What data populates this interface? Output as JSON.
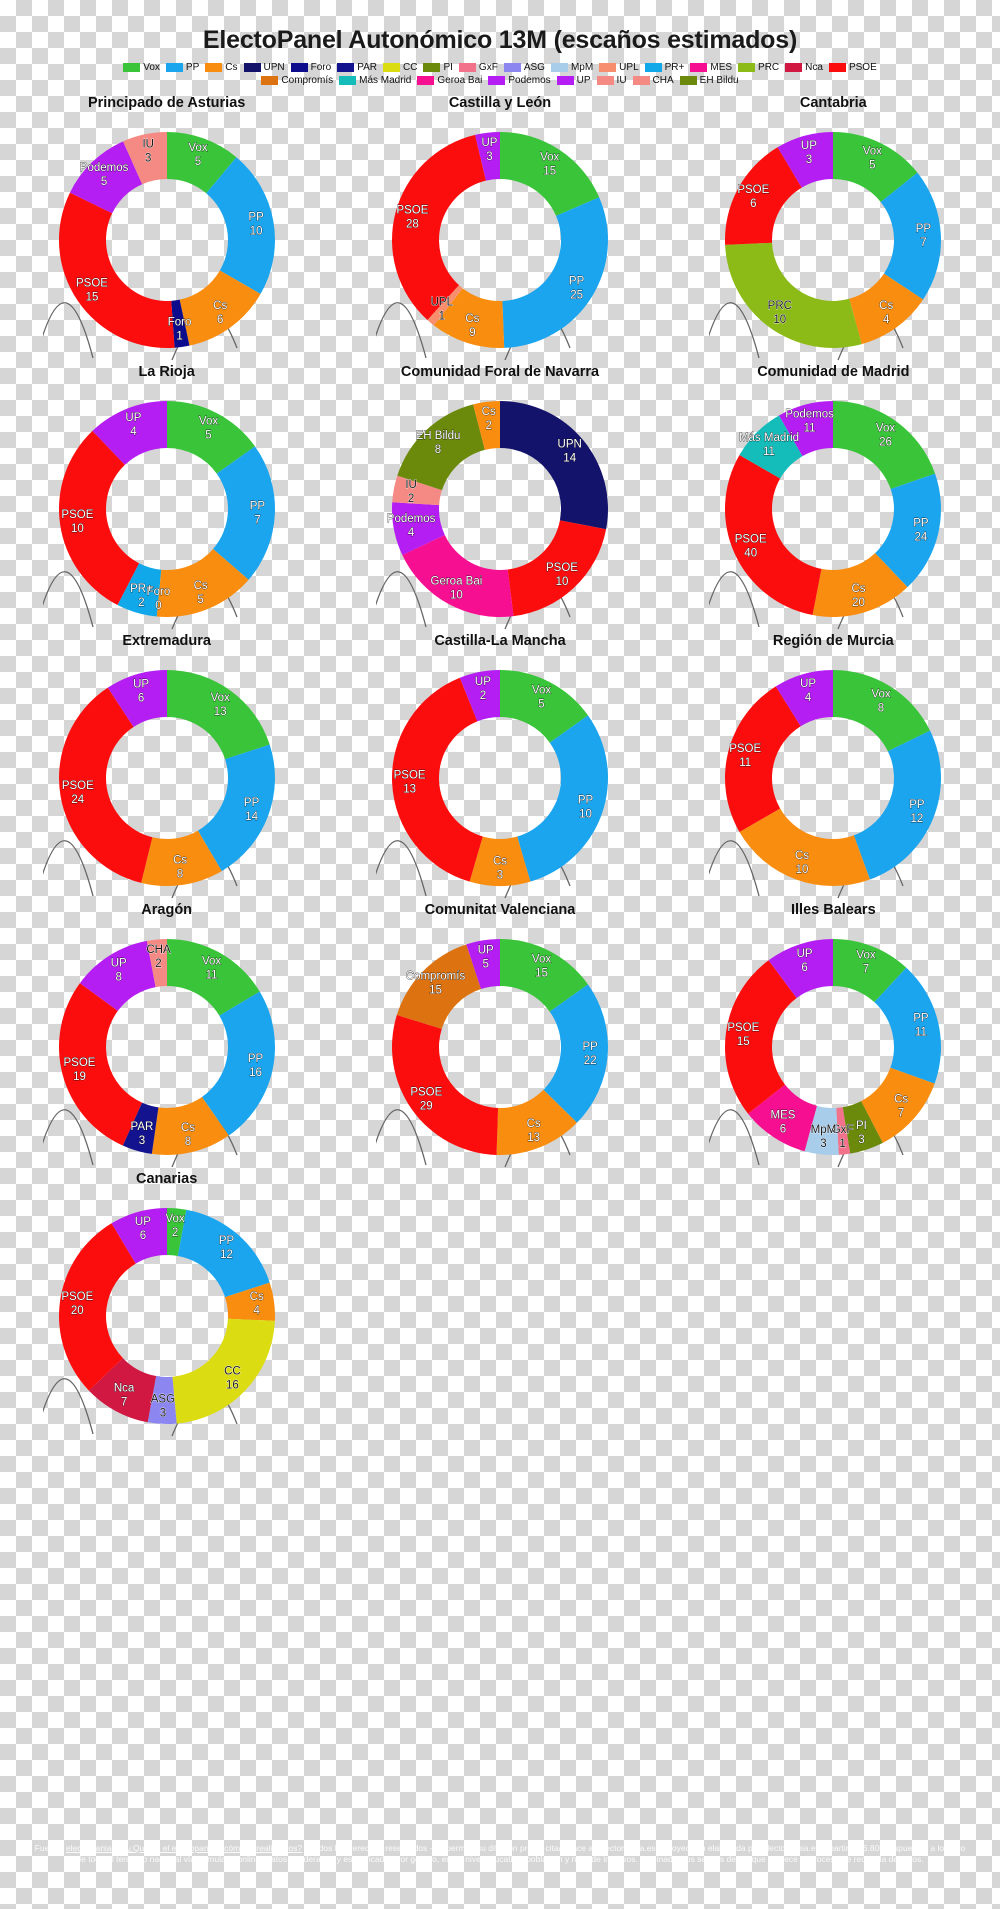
{
  "title": "ElectoPanel Autonómico 13M (escaños estimados)",
  "legend": {
    "row1": [
      {
        "label": "Vox",
        "color": "#3ac43a"
      },
      {
        "label": "PP",
        "color": "#1ca5ef"
      },
      {
        "label": "Cs",
        "color": "#f98d10"
      },
      {
        "label": "UPN",
        "color": "#14136b"
      },
      {
        "label": "Foro",
        "color": "#0c0c8c"
      },
      {
        "label": "PAR",
        "color": "#13138f"
      },
      {
        "label": "CC",
        "color": "#dcdc12"
      },
      {
        "label": "PI",
        "color": "#6b8a0c"
      },
      {
        "label": "GxF",
        "color": "#f2718b"
      },
      {
        "label": "ASG",
        "color": "#8b86f0"
      },
      {
        "label": "MpM",
        "color": "#a8cdeb"
      },
      {
        "label": "UPL",
        "color": "#f78f6e"
      },
      {
        "label": "PR+",
        "color": "#11a8ea"
      },
      {
        "label": "MES",
        "color": "#f70f92"
      },
      {
        "label": "PRC",
        "color": "#8cbb18"
      },
      {
        "label": "Nca",
        "color": "#d01842"
      },
      {
        "label": "PSOE",
        "color": "#fc0d0d"
      }
    ],
    "row2": [
      {
        "label": "Compromís",
        "color": "#dd7210"
      },
      {
        "label": "Más Madrid",
        "color": "#14bcba"
      },
      {
        "label": "Geroa Bai",
        "color": "#f70f92"
      },
      {
        "label": "Podemos",
        "color": "#b51ef2"
      },
      {
        "label": "UP",
        "color": "#b51ef2"
      },
      {
        "label": "IU",
        "color": "#f58a84"
      },
      {
        "label": "CHA",
        "color": "#f58a84"
      },
      {
        "label": "EH Bildu",
        "color": "#6b8a0c"
      }
    ]
  },
  "chart_data": [
    {
      "type": "pie",
      "title": "Principado de Asturias",
      "start_angle_deg": 0,
      "categories": [
        "Vox",
        "PP",
        "Cs",
        "Foro",
        "PSOE",
        "Podemos",
        "IU"
      ],
      "values": [
        5,
        10,
        6,
        1,
        15,
        5,
        3
      ],
      "colors": [
        "#3ac43a",
        "#1ca5ef",
        "#f98d10",
        "#0c0c8c",
        "#fc0d0d",
        "#b51ef2",
        "#f58a84"
      ]
    },
    {
      "type": "pie",
      "title": "Castilla y León",
      "start_angle_deg": 0,
      "categories": [
        "Vox",
        "PP",
        "Cs",
        "UPL",
        "PSOE",
        "UP"
      ],
      "values": [
        15,
        25,
        9,
        1,
        28,
        3
      ],
      "colors": [
        "#3ac43a",
        "#1ca5ef",
        "#f98d10",
        "#f78f6e",
        "#fc0d0d",
        "#b51ef2"
      ]
    },
    {
      "type": "pie",
      "title": "Cantabria",
      "start_angle_deg": 0,
      "categories": [
        "Vox",
        "PP",
        "Cs",
        "PRC",
        "PSOE",
        "UP"
      ],
      "values": [
        5,
        7,
        4,
        10,
        6,
        3
      ],
      "colors": [
        "#3ac43a",
        "#1ca5ef",
        "#f98d10",
        "#8cbb18",
        "#fc0d0d",
        "#b51ef2"
      ]
    },
    {
      "type": "pie",
      "title": "La Rioja",
      "start_angle_deg": 0,
      "categories": [
        "Vox",
        "PP",
        "Cs",
        "Foro",
        "PR+",
        "PSOE",
        "UP"
      ],
      "values": [
        5,
        7,
        5,
        0,
        2,
        10,
        4
      ],
      "colors": [
        "#3ac43a",
        "#1ca5ef",
        "#f98d10",
        "#0c0c8c",
        "#11a8ea",
        "#fc0d0d",
        "#b51ef2"
      ]
    },
    {
      "type": "pie",
      "title": "Comunidad Foral de Navarra",
      "start_angle_deg": 0,
      "categories": [
        "UPN",
        "PSOE",
        "Geroa Bai",
        "Podemos",
        "IU",
        "EH Bildu",
        "Cs"
      ],
      "values": [
        14,
        10,
        10,
        4,
        2,
        8,
        2
      ],
      "colors": [
        "#14136b",
        "#fc0d0d",
        "#f70f92",
        "#b51ef2",
        "#f58a84",
        "#6b8a0c",
        "#f98d10"
      ]
    },
    {
      "type": "pie",
      "title": "Comunidad de Madrid",
      "start_angle_deg": 0,
      "categories": [
        "Vox",
        "PP",
        "Cs",
        "PSOE",
        "Más Madrid",
        "Podemos"
      ],
      "values": [
        26,
        24,
        20,
        40,
        11,
        11
      ],
      "colors": [
        "#3ac43a",
        "#1ca5ef",
        "#f98d10",
        "#fc0d0d",
        "#14bcba",
        "#b51ef2"
      ]
    },
    {
      "type": "pie",
      "title": "Extremadura",
      "start_angle_deg": 0,
      "categories": [
        "Vox",
        "PP",
        "Cs",
        "PSOE",
        "UP"
      ],
      "values": [
        13,
        14,
        8,
        24,
        6
      ],
      "colors": [
        "#3ac43a",
        "#1ca5ef",
        "#f98d10",
        "#fc0d0d",
        "#b51ef2"
      ]
    },
    {
      "type": "pie",
      "title": "Castilla-La Mancha",
      "start_angle_deg": 0,
      "categories": [
        "Vox",
        "PP",
        "Cs",
        "PSOE",
        "UP"
      ],
      "values": [
        5,
        10,
        3,
        13,
        2
      ],
      "colors": [
        "#3ac43a",
        "#1ca5ef",
        "#f98d10",
        "#fc0d0d",
        "#b51ef2"
      ]
    },
    {
      "type": "pie",
      "title": "Región de Murcia",
      "start_angle_deg": 0,
      "categories": [
        "Vox",
        "PP",
        "Cs",
        "PSOE",
        "UP"
      ],
      "values": [
        8,
        12,
        10,
        11,
        4
      ],
      "colors": [
        "#3ac43a",
        "#1ca5ef",
        "#f98d10",
        "#fc0d0d",
        "#b51ef2"
      ]
    },
    {
      "type": "pie",
      "title": "Aragón",
      "start_angle_deg": 0,
      "categories": [
        "Vox",
        "PP",
        "Cs",
        "PAR",
        "PSOE",
        "UP",
        "CHA"
      ],
      "values": [
        11,
        16,
        8,
        3,
        19,
        8,
        2
      ],
      "colors": [
        "#3ac43a",
        "#1ca5ef",
        "#f98d10",
        "#13138f",
        "#fc0d0d",
        "#b51ef2",
        "#f58a84"
      ]
    },
    {
      "type": "pie",
      "title": "Comunitat Valenciana",
      "start_angle_deg": 0,
      "categories": [
        "Vox",
        "PP",
        "Cs",
        "PSOE",
        "Compromís",
        "UP"
      ],
      "values": [
        15,
        22,
        13,
        29,
        15,
        5
      ],
      "colors": [
        "#3ac43a",
        "#1ca5ef",
        "#f98d10",
        "#fc0d0d",
        "#dd7210",
        "#b51ef2"
      ]
    },
    {
      "type": "pie",
      "title": "Illes Balears",
      "start_angle_deg": 0,
      "categories": [
        "Vox",
        "PP",
        "Cs",
        "PI",
        "GxF",
        "MpM",
        "MES",
        "PSOE",
        "UP"
      ],
      "values": [
        7,
        11,
        7,
        3,
        1,
        3,
        6,
        15,
        6
      ],
      "colors": [
        "#3ac43a",
        "#1ca5ef",
        "#f98d10",
        "#6b8a0c",
        "#f2718b",
        "#a8cdeb",
        "#f70f92",
        "#fc0d0d",
        "#b51ef2"
      ]
    },
    {
      "type": "pie",
      "title": "Canarias",
      "start_angle_deg": 0,
      "categories": [
        "Vox",
        "PP",
        "Cs",
        "CC",
        "ASG",
        "Nca",
        "PSOE",
        "UP"
      ],
      "values": [
        2,
        12,
        4,
        16,
        3,
        7,
        20,
        6
      ],
      "colors": [
        "#3ac43a",
        "#1ca5ef",
        "#f98d10",
        "#dcdc12",
        "#8b86f0",
        "#d01842",
        "#fc0d0d",
        "#b51ef2"
      ]
    }
  ],
  "footer": {
    "prefix": "Fuente: ",
    "link1": "electomania.es",
    "sep1": ", ",
    "link2": "¿Qué es el electopanel y cómo lo realizamos?",
    "text": " • Todos los derechos reservados - se permite su difusión previa cita/enlace a \"electomania.es\". Proyección elaborada por electomania.es a partir de 6.800 respuestas a lo largo de todo el territorio nacional vía formulario online. Datos ponderados y estratificados por género, edad, nivel educativo, población y nivel de ingresos. Eliminados los sesgos de los que adolece el proceso de recogida de datos."
  }
}
